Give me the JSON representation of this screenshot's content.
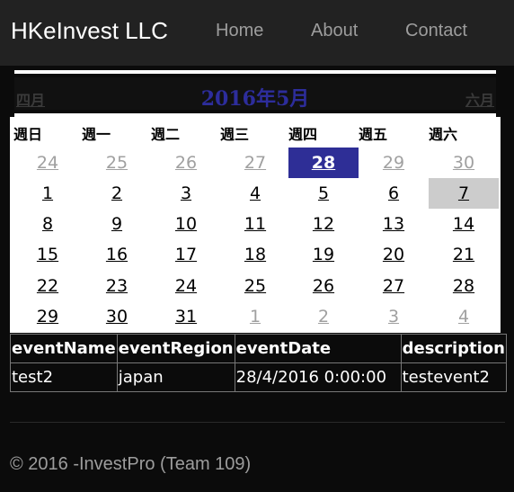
{
  "navbar": {
    "brand": "HKeInvest LLC",
    "links": [
      "Home",
      "About",
      "Contact"
    ]
  },
  "calendar": {
    "title": "2016年5月",
    "prev": "四月",
    "next": "六月",
    "weekdays": [
      "週日",
      "週一",
      "週二",
      "週三",
      "週四",
      "週五",
      "週六"
    ],
    "weeks": [
      [
        "24",
        "25",
        "26",
        "27",
        "28",
        "29",
        "30"
      ],
      [
        "1",
        "2",
        "3",
        "4",
        "5",
        "6",
        "7"
      ],
      [
        "8",
        "9",
        "10",
        "11",
        "12",
        "13",
        "14"
      ],
      [
        "15",
        "16",
        "17",
        "18",
        "19",
        "20",
        "21"
      ],
      [
        "22",
        "23",
        "24",
        "25",
        "26",
        "27",
        "28"
      ],
      [
        "29",
        "30",
        "31",
        "1",
        "2",
        "3",
        "4"
      ]
    ],
    "selected_day": "28",
    "today_day": "7",
    "colors": {
      "selected": "#2e2e96",
      "today": "#cccccc",
      "title": "#2d2d9c"
    }
  },
  "events_table": {
    "headers": [
      "eventName",
      "eventRegion",
      "eventDate",
      "description"
    ],
    "rows": [
      [
        "test2",
        "japan",
        "28/4/2016 0:00:00",
        "testevent2"
      ]
    ]
  },
  "footer": {
    "text": "© 2016 -InvestPro (Team 109)"
  }
}
